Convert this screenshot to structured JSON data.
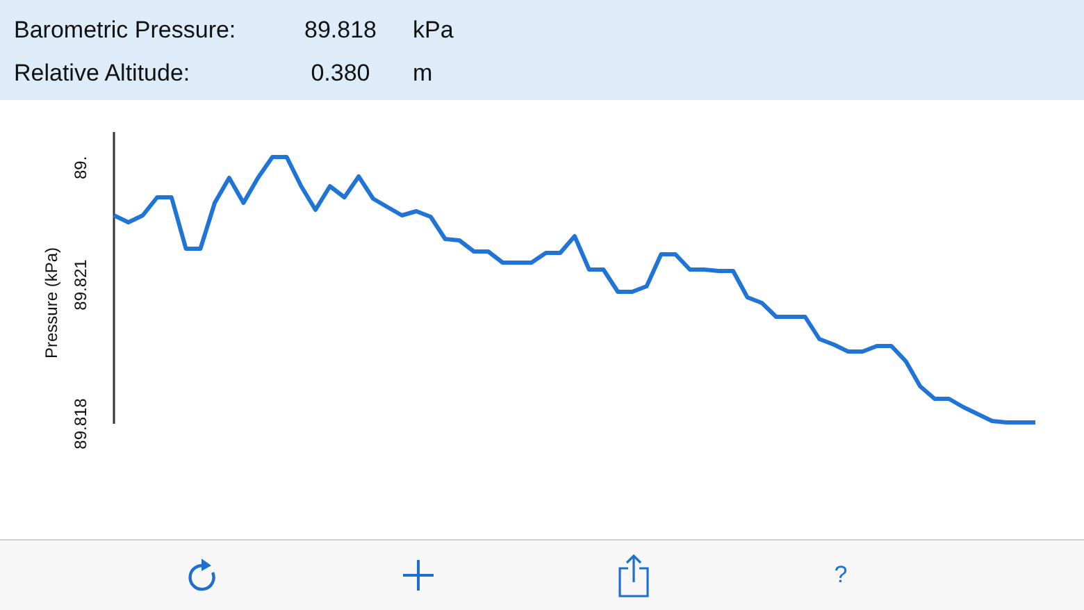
{
  "readings": [
    {
      "label": "Barometric Pressure:",
      "value": "89.818",
      "unit": "kPa"
    },
    {
      "label": "Relative Altitude:",
      "value": "0.380",
      "unit": "m"
    }
  ],
  "chart": {
    "chart_data": {
      "type": "line",
      "ylabel": "Pressure (kPa)",
      "ylim": [
        89.818,
        89.8243
      ],
      "yticks": [
        89.818,
        89.821
      ],
      "series": [
        {
          "color": "#1f74d6",
          "values": [
            89.8225,
            89.82235,
            89.8225,
            89.82289,
            89.82289,
            89.82178,
            89.82178,
            89.82277,
            89.82331,
            89.82277,
            89.82331,
            89.82376,
            89.82376,
            89.82313,
            89.82262,
            89.82313,
            89.82289,
            89.82334,
            89.82286,
            89.82268,
            89.8225,
            89.82259,
            89.82247,
            89.82199,
            89.82196,
            89.82172,
            89.82172,
            89.82148,
            89.82148,
            89.82148,
            89.82169,
            89.82169,
            89.82205,
            89.82133,
            89.82133,
            89.82085,
            89.82085,
            89.82097,
            89.82166,
            89.82166,
            89.82133,
            89.82133,
            89.8213,
            89.8213,
            89.82073,
            89.82061,
            89.82031,
            89.82031,
            89.82031,
            89.81983,
            89.81971,
            89.81956,
            89.81956,
            89.81968,
            89.81968,
            89.81935,
            89.81881,
            89.81854,
            89.81854,
            89.81836,
            89.81821,
            89.81806,
            89.81803,
            89.81803,
            89.81803
          ]
        }
      ]
    },
    "cut_tick_label": "89."
  },
  "toolbar": [
    {
      "kind": "refresh"
    },
    {
      "kind": "add"
    },
    {
      "kind": "share"
    },
    {
      "kind": "help",
      "label": "?"
    }
  ]
}
